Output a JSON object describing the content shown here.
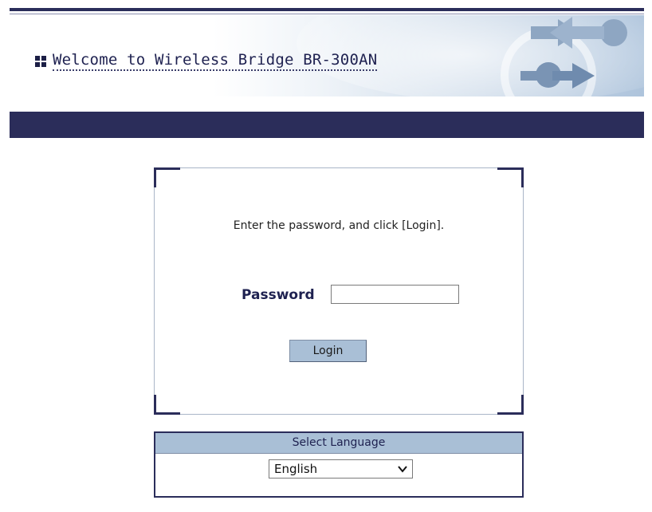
{
  "header": {
    "title": "Welcome to Wireless Bridge BR-300AN",
    "icon": "grid-icon",
    "decoration": "arrows-graphic"
  },
  "colors": {
    "navy": "#2b2d5a",
    "accent_blue": "#a9bfd6"
  },
  "login": {
    "instruction": "Enter the password, and click [Login].",
    "password_label": "Password",
    "password_value": "",
    "login_button": "Login"
  },
  "language": {
    "heading": "Select Language",
    "selected": "English",
    "dropdown_icon": "chevron-down-icon"
  }
}
